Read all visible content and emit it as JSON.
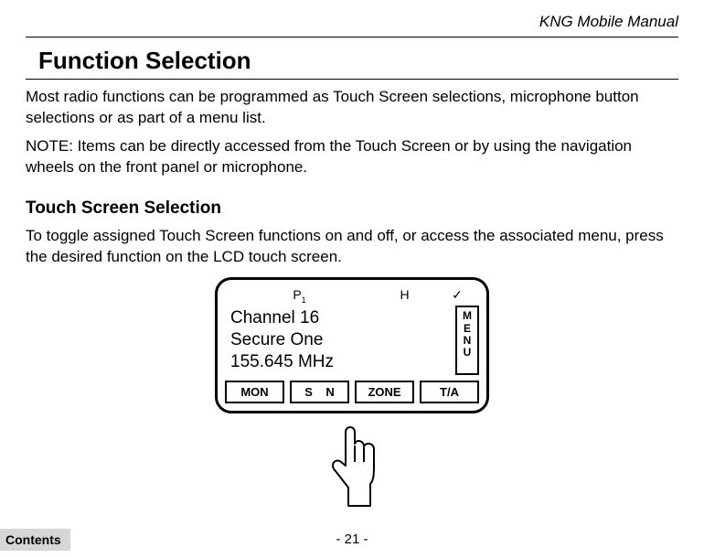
{
  "header": {
    "running": "KNG Mobile Manual"
  },
  "section": {
    "title": "Function Selection",
    "p1": "Most radio functions can be programmed as Touch Screen selections, microphone button selections or as part of a menu list.",
    "p2": "NOTE: Items can be directly accessed from the Touch Screen or by using the navigation wheels on the front panel or microphone."
  },
  "sub": {
    "title": "Touch Screen Selection",
    "p1": "To toggle assigned Touch Screen functions on and off, or access the associated menu, press the desired function on the LCD touch screen."
  },
  "screen": {
    "status": {
      "blank1": "",
      "p": "P",
      "psub": "1",
      "blank2": "",
      "h": "H",
      "check": "✓"
    },
    "line1": "Channel 16",
    "line2": "Secure One",
    "line3": "155.645 MHz",
    "menu": {
      "m": "M",
      "e": "E",
      "n": "N",
      "u": "U"
    },
    "buttons": {
      "mon": "MON",
      "scan_left": "S",
      "scan_right": "N",
      "zone": "ZONE",
      "ta": "T/A"
    }
  },
  "footer": {
    "page": "- 21 -",
    "contents": "Contents"
  }
}
